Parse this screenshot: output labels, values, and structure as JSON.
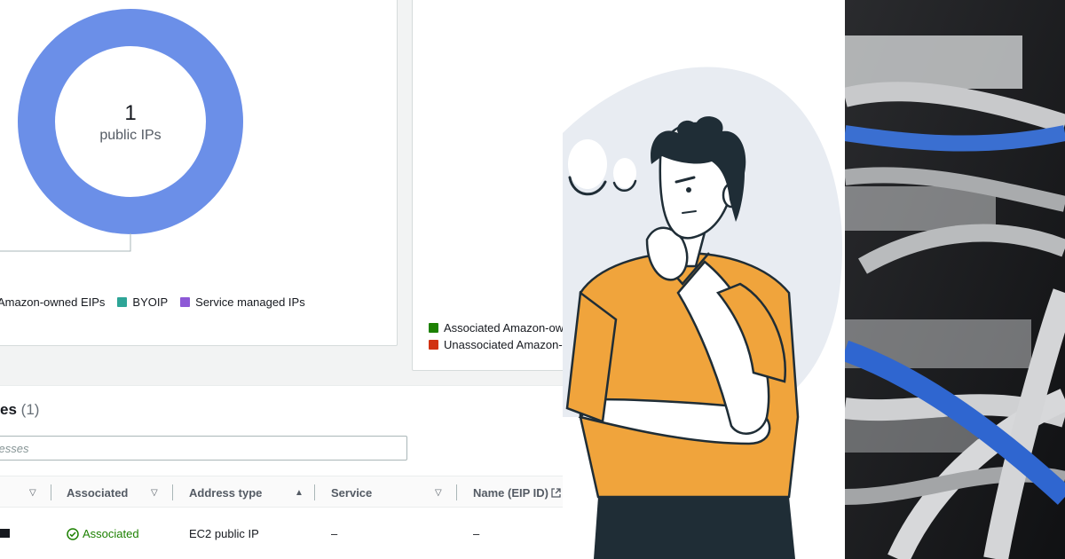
{
  "summary_left": {
    "donut_value": "1",
    "donut_caption": "public IPs",
    "legend": [
      {
        "label": "Amazon-owned EIPs",
        "color": "#6b8fe8"
      },
      {
        "label": "BYOIP",
        "color": "#2ea597"
      },
      {
        "label": "Service managed IPs",
        "color": "#8d59d6"
      }
    ]
  },
  "summary_right": {
    "legend": [
      {
        "label": "Associated Amazon-ow",
        "color": "#1d8102"
      },
      {
        "label": "Unassociated Amazon-",
        "color": "#d13212"
      }
    ]
  },
  "table": {
    "title": "es",
    "count": "(1)",
    "search_placeholder": "dresses",
    "columns": [
      {
        "label": "",
        "sort": "chevron-down-icon"
      },
      {
        "label": "Associated",
        "sort": "chevron-down-icon"
      },
      {
        "label": "Address type",
        "sort": "triangle-up-icon"
      },
      {
        "label": "Service",
        "sort": "chevron-down-icon"
      },
      {
        "label": "Name (EIP ID)",
        "sort": "external-link-icon"
      }
    ],
    "rows": [
      {
        "associated": "Associated",
        "address_type": "EC2 public IP",
        "service": "–",
        "name": "–"
      }
    ]
  },
  "colors": {
    "donut": "#6b8fe8",
    "shirt": "#f0a43c",
    "hair": "#1f2d36",
    "blob": "#e8ecf2",
    "status_ok": "#1d8102"
  }
}
